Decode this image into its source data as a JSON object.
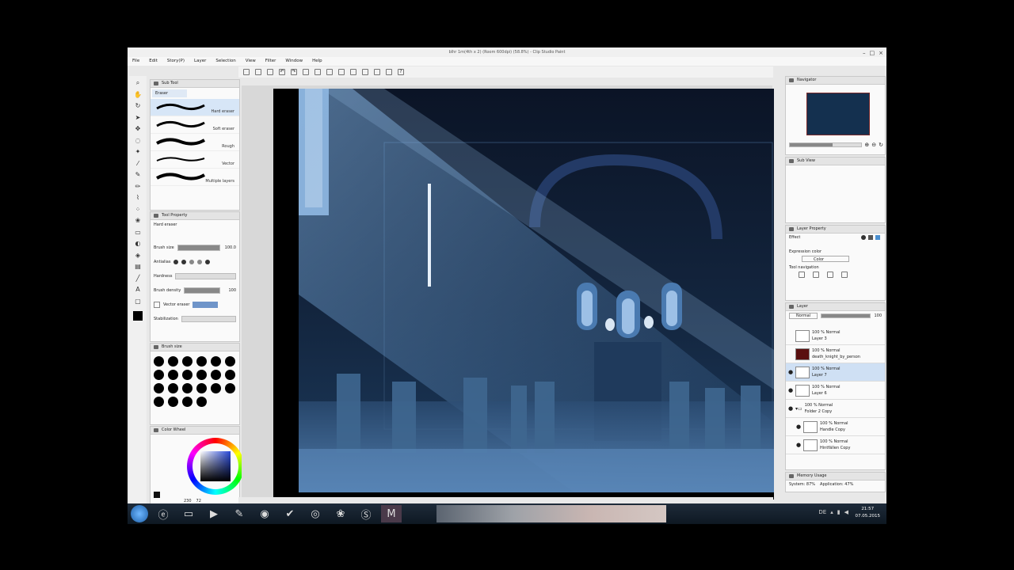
{
  "window": {
    "title": "blhr 1m(4th x 2) (Room 600dpi) (58.8%) - Clip Studio Paint"
  },
  "menu": [
    "File",
    "Edit",
    "Story(P)",
    "Layer",
    "Selection",
    "View",
    "Filter",
    "Window",
    "Help"
  ],
  "subtool": {
    "panel_title": "Sub Tool",
    "tab": "Eraser",
    "items": [
      "Hard eraser",
      "Soft eraser",
      "Rough",
      "Vector",
      "Multiple layers"
    ]
  },
  "tool_property": {
    "panel_title": "Tool Property",
    "current": "Hard eraser",
    "brush_size_label": "Brush size",
    "brush_size_value": "100.0",
    "antialias_label": "Antialias",
    "hardness_label": "Hardness",
    "brush_density_label": "Brush density",
    "brush_density_value": "100",
    "vector_eraser_label": "Vector eraser",
    "stabilization_label": "Stabilization"
  },
  "brush_size_panel": {
    "title": "Brush size"
  },
  "color_panel": {
    "title": "Color Wheel",
    "readout_h": "230",
    "readout_s": "72"
  },
  "navigator": {
    "title": "Navigator"
  },
  "subview": {
    "title": "Sub View"
  },
  "layer_property": {
    "title": "Layer Property",
    "effect_label": "Effect",
    "expression_color_label": "Expression color",
    "expression_color_value": "Color",
    "tool_navigation_label": "Tool navigation"
  },
  "layer_panel": {
    "title": "Layer",
    "blend_mode": "Normal",
    "opacity": "100",
    "layers": [
      {
        "opacity": "100 %",
        "mode": "Normal",
        "name": "Layer 3"
      },
      {
        "opacity": "100 %",
        "mode": "Normal",
        "name": "death_knight_by_person"
      },
      {
        "opacity": "100 %",
        "mode": "Normal",
        "name": "Layer 7"
      },
      {
        "opacity": "100 %",
        "mode": "Normal",
        "name": "Layer 6"
      },
      {
        "opacity": "100 %",
        "mode": "Normal",
        "name": "Folder 2 Copy"
      },
      {
        "opacity": "100 %",
        "mode": "Normal",
        "name": "Handle Copy"
      },
      {
        "opacity": "100 %",
        "mode": "Normal",
        "name": "Hintfällen Copy"
      }
    ]
  },
  "memory": {
    "title": "Memory Usage",
    "system": "System: 87%",
    "application": "Application: 47%"
  },
  "taskbar": {
    "lang": "DE",
    "time": "21:57",
    "date": "07.05.2015"
  }
}
